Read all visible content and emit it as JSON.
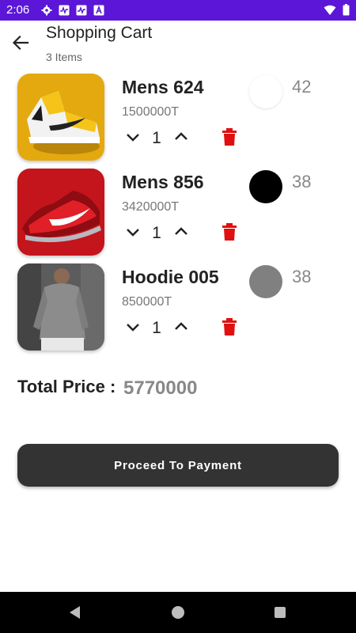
{
  "status_bar": {
    "time": "2:06",
    "icons": [
      "settings-icon",
      "activity-icon",
      "activity-icon",
      "text-a-icon",
      "wifi-icon",
      "battery-icon"
    ],
    "background": "#5b16d8"
  },
  "header": {
    "title": "Shopping Cart",
    "item_count": "3 Items"
  },
  "cart": {
    "items": [
      {
        "name": "Mens 624",
        "price": "1500000T",
        "quantity": "1",
        "size": "42",
        "color": "#ffffff",
        "image": "yellow-sneaker"
      },
      {
        "name": "Mens 856",
        "price": "3420000T",
        "quantity": "1",
        "size": "38",
        "color": "#000000",
        "image": "red-sneaker"
      },
      {
        "name": "Hoodie 005",
        "price": "850000T",
        "quantity": "1",
        "size": "38",
        "color": "#808080",
        "image": "gray-hoodie"
      }
    ]
  },
  "total": {
    "label": "Total Price :",
    "value": "5770000"
  },
  "payment": {
    "button_label": "Proceed To Payment"
  },
  "colors": {
    "accent": "#5b16d8",
    "button": "#333333",
    "delete": "#e01010"
  },
  "nav": {
    "icons": [
      "back-triangle-icon",
      "home-circle-icon",
      "recent-square-icon"
    ]
  }
}
